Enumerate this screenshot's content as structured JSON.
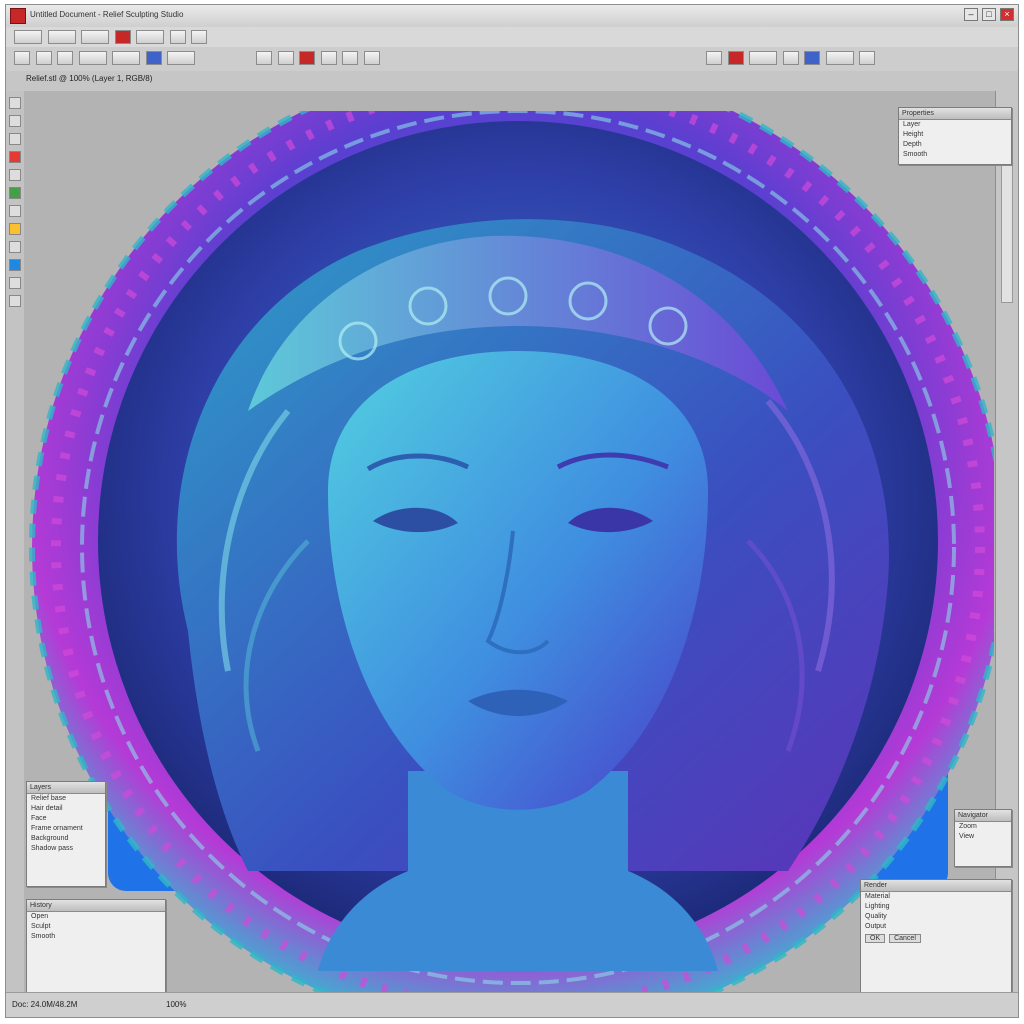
{
  "window": {
    "title": "Untitled Document - Relief Sculpting Studio",
    "min_label": "–",
    "max_label": "□",
    "close_label": "×"
  },
  "document": {
    "tab_label": "Relief.stl @ 100% (Layer 1, RGB/8)"
  },
  "panels": {
    "properties": {
      "title": "Properties",
      "rows": [
        "Layer",
        "Height",
        "Depth",
        "Smooth"
      ]
    },
    "layers_left": {
      "title": "Layers",
      "rows": [
        "Relief base",
        "Hair detail",
        "Face",
        "Frame ornament",
        "Background",
        "Shadow pass"
      ]
    },
    "history": {
      "title": "History",
      "rows": [
        "Open",
        "Sculpt",
        "Smooth"
      ]
    },
    "navigator": {
      "title": "Navigator",
      "rows": [
        "Zoom",
        "View"
      ]
    },
    "render": {
      "title": "Render",
      "rows": [
        "Material",
        "Lighting",
        "Quality",
        "Output"
      ],
      "ok_label": "OK",
      "cancel_label": "Cancel"
    }
  },
  "status": {
    "left_text": "Doc: 24.0M/48.2M",
    "zoom_text": "100%"
  },
  "colors": {
    "frame_purple": "#6d3fd1",
    "frame_magenta": "#c03ad8",
    "face_cyan": "#3fb7d6",
    "face_blue": "#3a4fd0",
    "backdrop_blue": "#1f72e8"
  },
  "icons": [
    "app-logo-icon",
    "minimize-icon",
    "maximize-icon",
    "close-icon"
  ]
}
